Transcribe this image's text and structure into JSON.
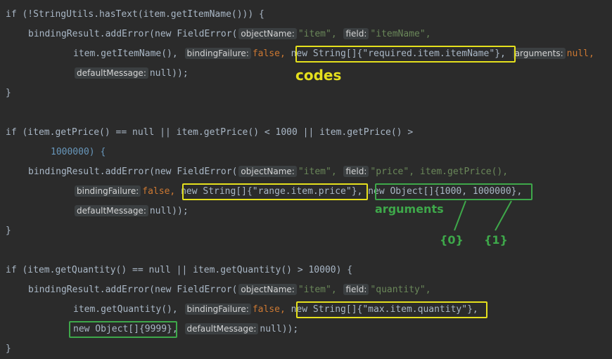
{
  "code": {
    "block1": {
      "if_open": "if (!StringUtils.hasText(item.getItemName())) {",
      "add_error": "bindingResult.addError(new FieldError(",
      "hint_objectName": "objectName:",
      "val_item": "\"item\",",
      "hint_field": "field:",
      "val_field": "\"itemName\",",
      "arg_getter": "item.getItemName(),",
      "hint_bindingFailure": "bindingFailure:",
      "val_false": "false,",
      "codes": "new String[]{\"required.item.itemName\"}",
      "comma": ",",
      "hint_arguments": "arguments:",
      "val_null": "null,",
      "hint_defaultMessage": "defaultMessage:",
      "val_end": "null));",
      "close": "}"
    },
    "block2": {
      "if_open": "if (item.getPrice() == null || item.getPrice() < 1000 || item.getPrice() >",
      "if_cont": "1000000) {",
      "add_error": "bindingResult.addError(new FieldError(",
      "hint_objectName": "objectName:",
      "val_item": "\"item\",",
      "hint_field": "field:",
      "val_field": "\"price\", item.getPrice(),",
      "hint_bindingFailure": "bindingFailure:",
      "val_false": "false,",
      "codes": "new String[]{\"range.item.price\"}",
      "comma": ",",
      "arguments": "new Object[]{1000, 1000000}",
      "comma2": ",",
      "hint_defaultMessage": "defaultMessage:",
      "val_end": "null));",
      "close": "}"
    },
    "block3": {
      "if_open": "if (item.getQuantity() == null || item.getQuantity() > 10000) {",
      "add_error": "bindingResult.addError(new FieldError(",
      "hint_objectName": "objectName:",
      "val_item": "\"item\",",
      "hint_field": "field:",
      "val_field": "\"quantity\",",
      "arg_getter": "item.getQuantity(),",
      "hint_bindingFailure": "bindingFailure:",
      "val_false": "false,",
      "codes": "new String[]{\"max.item.quantity\"}",
      "comma": ",",
      "arguments": "new Object[]{9999}",
      "comma2": ",",
      "hint_defaultMessage": "defaultMessage:",
      "val_end": "null));",
      "close": "}"
    }
  },
  "annotations": {
    "codes_label": "codes",
    "arguments_label": "arguments",
    "index0": "{0}",
    "index1": "{1}"
  },
  "colors": {
    "background": "#2b2b2b",
    "highlight_yellow": "#e5e01d",
    "highlight_green": "#3ea84a"
  }
}
